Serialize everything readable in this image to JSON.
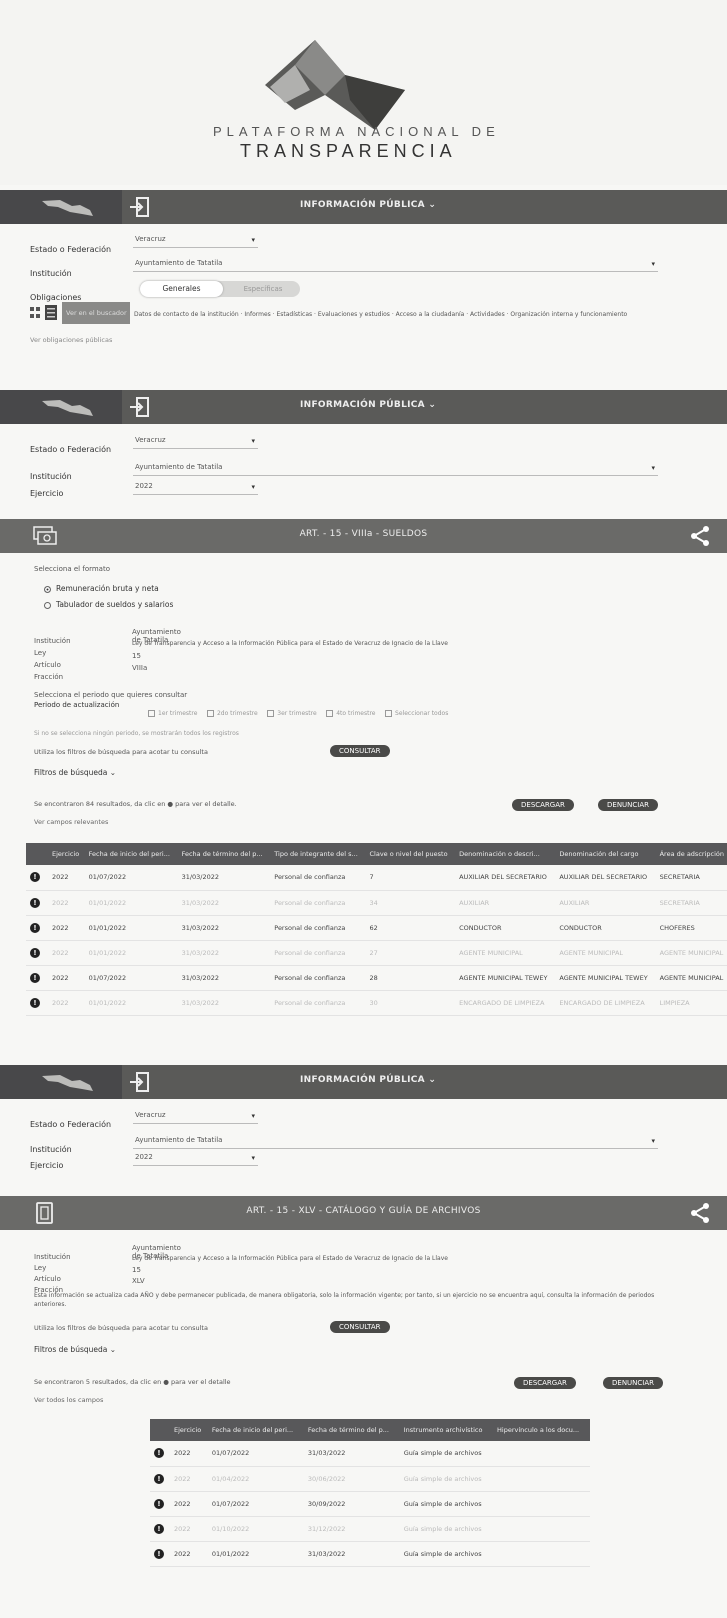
{
  "logo": {
    "line1": "PLATAFORMA NACIONAL DE",
    "line2": "TRANSPARENCIA"
  },
  "nav": {
    "title": "INFORMACIÓN PÚBLICA ⌄"
  },
  "form1": {
    "state_label": "Estado o Federación",
    "state_value": "Veracruz",
    "institution_label": "Institución",
    "institution_value": "Ayuntamiento de Tatatila",
    "obligations_label": "Obligaciones",
    "tab_general": "Generales",
    "tab_specific": "Específicas",
    "guide_button": "Ver en el buscador",
    "links_text": "Datos de contacto de la institución · Informes · Estadísticas · Evaluaciones y estudios · Acceso a la ciudadanía · Actividades · Organización interna y funcionamiento",
    "more_link": "Ver obligaciones públicas"
  },
  "form2": {
    "state_label": "Estado o Federación",
    "state_value": "Veracruz",
    "institution_label": "Institución",
    "institution_value": "Ayuntamiento de Tatatila",
    "year_label": "Ejercicio",
    "year_value": "2022"
  },
  "section1": {
    "title": "ART. - 15 - VIIIa - SUELDOS",
    "select_format": "Selecciona el formato",
    "radio1": "Remuneración bruta y neta",
    "radio2": "Tabulador de sueldos y salarios",
    "meta": [
      {
        "label": "Institución",
        "value": "Ayuntamiento de Tatatila"
      },
      {
        "label": "Ley",
        "value": "Ley de Transparencia y Acceso a la Información Pública para el Estado de Veracruz de Ignacio de la Llave"
      },
      {
        "label": "Artículo",
        "value": "15"
      },
      {
        "label": "Fracción",
        "value": "VIIIa"
      }
    ],
    "period_prompt": "Selecciona el periodo que quieres consultar",
    "period_label": "Periodo de actualización",
    "periods": [
      "1er trimestre",
      "2do trimestre",
      "3er trimestre",
      "4to trimestre",
      "Seleccionar todos"
    ],
    "period_note": "Si no se selecciona ningún periodo, se mostrarán todos los registros",
    "filter_prompt": "Utiliza los filtros de búsqueda para acotar tu consulta",
    "consult_button": "CONSULTAR",
    "filters_toggle": "Filtros de búsqueda ⌄",
    "results_text": "Se encontraron 84 resultados, da clic en ● para ver el detalle.",
    "columns_link": "Ver campos relevantes",
    "download_button": "DESCARGAR",
    "report_button": "DENUNCIAR",
    "columns": [
      "Ejercicio",
      "Fecha de inicio del peri...",
      "Fecha de término del p...",
      "Tipo de integrante del s...",
      "Clave o nivel del puesto",
      "Denominación o descri...",
      "Denominación del cargo",
      "Área de adscripción"
    ],
    "rows": [
      {
        "faded": false,
        "cells": [
          "2022",
          "01/07/2022",
          "31/03/2022",
          "Personal de confianza",
          "7",
          "AUXILIAR DEL SECRETARIO",
          "AUXILIAR DEL SECRETARIO",
          "SECRETARIA"
        ]
      },
      {
        "faded": true,
        "cells": [
          "2022",
          "01/01/2022",
          "31/03/2022",
          "Personal de confianza",
          "34",
          "AUXILIAR",
          "AUXILIAR",
          "SECRETARIA"
        ]
      },
      {
        "faded": false,
        "cells": [
          "2022",
          "01/01/2022",
          "31/03/2022",
          "Personal de confianza",
          "62",
          "CONDUCTOR",
          "CONDUCTOR",
          "CHOFERES"
        ]
      },
      {
        "faded": true,
        "cells": [
          "2022",
          "01/01/2022",
          "31/03/2022",
          "Personal de confianza",
          "27",
          "AGENTE MUNICIPAL",
          "AGENTE MUNICIPAL",
          "AGENTE MUNICIPAL"
        ]
      },
      {
        "faded": false,
        "cells": [
          "2022",
          "01/07/2022",
          "31/03/2022",
          "Personal de confianza",
          "28",
          "AGENTE MUNICIPAL TEWEY",
          "AGENTE MUNICIPAL TEWEY",
          "AGENTE MUNICIPAL"
        ]
      },
      {
        "faded": true,
        "cells": [
          "2022",
          "01/01/2022",
          "31/03/2022",
          "Personal de confianza",
          "30",
          "ENCARGADO DE LIMPIEZA",
          "ENCARGADO DE LIMPIEZA",
          "LIMPIEZA"
        ]
      }
    ]
  },
  "form3": {
    "state_label": "Estado o Federación",
    "state_value": "Veracruz",
    "institution_label": "Institución",
    "institution_value": "Ayuntamiento de Tatatila",
    "year_label": "Ejercicio",
    "year_value": "2022"
  },
  "section2": {
    "title": "ART. - 15 - XLV - CATÁLOGO Y GUÍA DE ARCHIVOS",
    "meta": [
      {
        "label": "Institución",
        "value": "Ayuntamiento de Tatatila"
      },
      {
        "label": "Ley",
        "value": "Ley de Transparencia y Acceso a la Información Pública para el Estado de Veracruz de Ignacio de la Llave"
      },
      {
        "label": "Artículo",
        "value": "15"
      },
      {
        "label": "Fracción",
        "value": "XLV"
      }
    ],
    "note": "Esta información se actualiza cada AÑO y debe permanecer publicada, de manera obligatoria, solo la información vigente; por tanto, si un ejercicio no se encuentra aquí, consulta la información de periodos anteriores.",
    "filter_prompt": "Utiliza los filtros de búsqueda para acotar tu consulta",
    "consult_button": "CONSULTAR",
    "filters_toggle": "Filtros de búsqueda ⌄",
    "results_text": "Se encontraron 5 resultados, da clic en ● para ver el detalle",
    "columns_link": "Ver todos los campos",
    "download_button": "DESCARGAR",
    "report_button": "DENUNCIAR",
    "columns": [
      "Ejercicio",
      "Fecha de inicio del peri...",
      "Fecha de término del p...",
      "Instrumento archivístico",
      "Hipervínculo a los docu..."
    ],
    "rows": [
      {
        "faded": false,
        "cells": [
          "2022",
          "01/07/2022",
          "31/03/2022",
          "Guía simple de archivos",
          ""
        ]
      },
      {
        "faded": true,
        "cells": [
          "2022",
          "01/04/2022",
          "30/06/2022",
          "Guía simple de archivos",
          ""
        ]
      },
      {
        "faded": false,
        "cells": [
          "2022",
          "01/07/2022",
          "30/09/2022",
          "Guía simple de archivos",
          ""
        ]
      },
      {
        "faded": true,
        "cells": [
          "2022",
          "01/10/2022",
          "31/12/2022",
          "Guía simple de archivos",
          ""
        ]
      },
      {
        "faded": false,
        "cells": [
          "2022",
          "01/01/2022",
          "31/03/2022",
          "Guía simple de archivos",
          ""
        ]
      }
    ]
  }
}
